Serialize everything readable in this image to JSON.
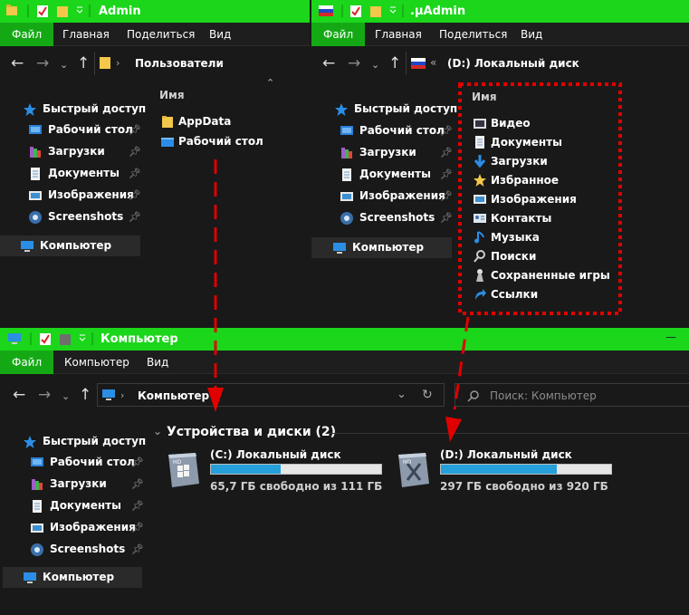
{
  "win1": {
    "title": "Admin",
    "tabs": [
      "Файл",
      "Главная",
      "Поделиться",
      "Вид"
    ],
    "path": "Пользователи",
    "col_header": "Имя",
    "items": [
      {
        "label": "AppData",
        "icon": "folder-icon"
      },
      {
        "label": "Рабочий стол",
        "icon": "desktop-folder-icon"
      }
    ],
    "sidebar": [
      {
        "label": "Быстрый доступ",
        "icon": "star-icon",
        "pinned": false
      },
      {
        "label": "Рабочий стол",
        "icon": "desktop-icon",
        "pinned": true
      },
      {
        "label": "Загрузки",
        "icon": "downloads-icon",
        "pinned": true
      },
      {
        "label": "Документы",
        "icon": "documents-icon",
        "pinned": true
      },
      {
        "label": "Изображения",
        "icon": "pictures-icon",
        "pinned": true
      },
      {
        "label": "Screenshots",
        "icon": "screenshots-icon",
        "pinned": true
      },
      {
        "label": "Компьютер",
        "icon": "computer-icon",
        "pinned": false
      }
    ]
  },
  "win2": {
    "title": ".µAdmin",
    "tabs": [
      "Файл",
      "Главная",
      "Поделиться",
      "Вид"
    ],
    "path": "(D:) Локальный диск",
    "col_header": "Имя",
    "items": [
      {
        "label": "Видео",
        "icon": "video-icon"
      },
      {
        "label": "Документы",
        "icon": "documents-icon"
      },
      {
        "label": "Загрузки",
        "icon": "downloads-icon"
      },
      {
        "label": "Избранное",
        "icon": "favorites-icon"
      },
      {
        "label": "Изображения",
        "icon": "pictures-icon"
      },
      {
        "label": "Контакты",
        "icon": "contacts-icon"
      },
      {
        "label": "Музыка",
        "icon": "music-icon"
      },
      {
        "label": "Поиски",
        "icon": "searches-icon"
      },
      {
        "label": "Сохраненные игры",
        "icon": "saved-games-icon"
      },
      {
        "label": "Ссылки",
        "icon": "links-icon"
      }
    ],
    "sidebar": [
      {
        "label": "Быстрый доступ",
        "icon": "star-icon",
        "pinned": false
      },
      {
        "label": "Рабочий стол",
        "icon": "desktop-icon",
        "pinned": true
      },
      {
        "label": "Загрузки",
        "icon": "downloads-icon",
        "pinned": true
      },
      {
        "label": "Документы",
        "icon": "documents-icon",
        "pinned": true
      },
      {
        "label": "Изображения",
        "icon": "pictures-icon",
        "pinned": true
      },
      {
        "label": "Screenshots",
        "icon": "screenshots-icon",
        "pinned": true
      },
      {
        "label": "Компьютер",
        "icon": "computer-icon",
        "pinned": false
      }
    ]
  },
  "win3": {
    "title": "Компьютер",
    "minimize": "—",
    "tabs": [
      "Файл",
      "Компьютер",
      "Вид"
    ],
    "path": "Компьютер",
    "search_placeholder": "Поиск: Компьютер",
    "group_header": "Устройства и диски (2)",
    "drives": [
      {
        "name": "(C:) Локальный диск",
        "free": "65,7 ГБ свободно из 111 ГБ",
        "used_fraction": 0.41
      },
      {
        "name": "(D:) Локальный диск",
        "free": "297 ГБ свободно из 920 ГБ",
        "used_fraction": 0.68
      }
    ],
    "sidebar": [
      {
        "label": "Быстрый доступ",
        "icon": "star-icon",
        "pinned": false
      },
      {
        "label": "Рабочий стол",
        "icon": "desktop-icon",
        "pinned": true
      },
      {
        "label": "Загрузки",
        "icon": "downloads-icon",
        "pinned": true
      },
      {
        "label": "Документы",
        "icon": "documents-icon",
        "pinned": true
      },
      {
        "label": "Изображения",
        "icon": "pictures-icon",
        "pinned": true
      },
      {
        "label": "Screenshots",
        "icon": "screenshots-icon",
        "pinned": true
      },
      {
        "label": "Компьютер",
        "icon": "computer-icon",
        "pinned": false
      }
    ]
  },
  "colors": {
    "titlebar": "#1bd61b",
    "file_tab": "#14a914",
    "background": "#191919",
    "accent_red": "#e00000",
    "drive_bar": "#26a0da"
  }
}
